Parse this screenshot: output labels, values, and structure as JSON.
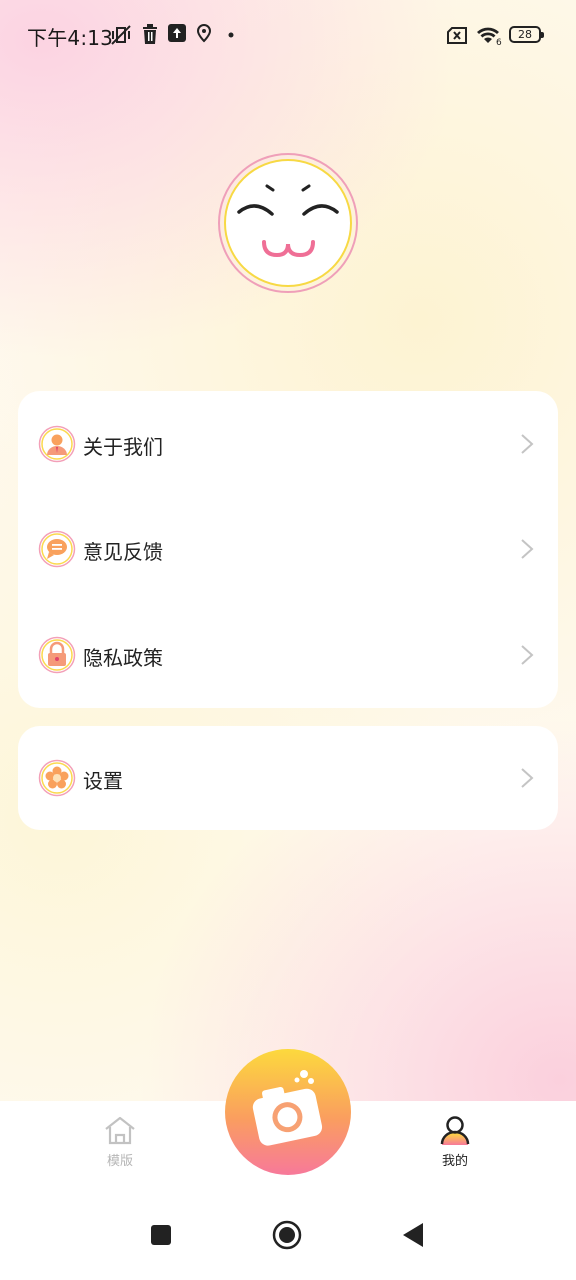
{
  "status_bar": {
    "time": "下午4:13",
    "battery": "28",
    "network": "6"
  },
  "menu_main": [
    {
      "label": "关于我们",
      "icon": "user-badge-icon"
    },
    {
      "label": "意见反馈",
      "icon": "chat-bubble-icon"
    },
    {
      "label": "隐私政策",
      "icon": "lock-icon"
    }
  ],
  "menu_settings": [
    {
      "label": "设置",
      "icon": "flower-gear-icon"
    }
  ],
  "bottom_nav": {
    "home_label": "模版",
    "mine_label": "我的",
    "active_tab": "mine"
  },
  "colors": {
    "accent_yellow": "#fcd93d",
    "accent_pink": "#f7799a",
    "inactive_gray": "#b6b6b6"
  }
}
